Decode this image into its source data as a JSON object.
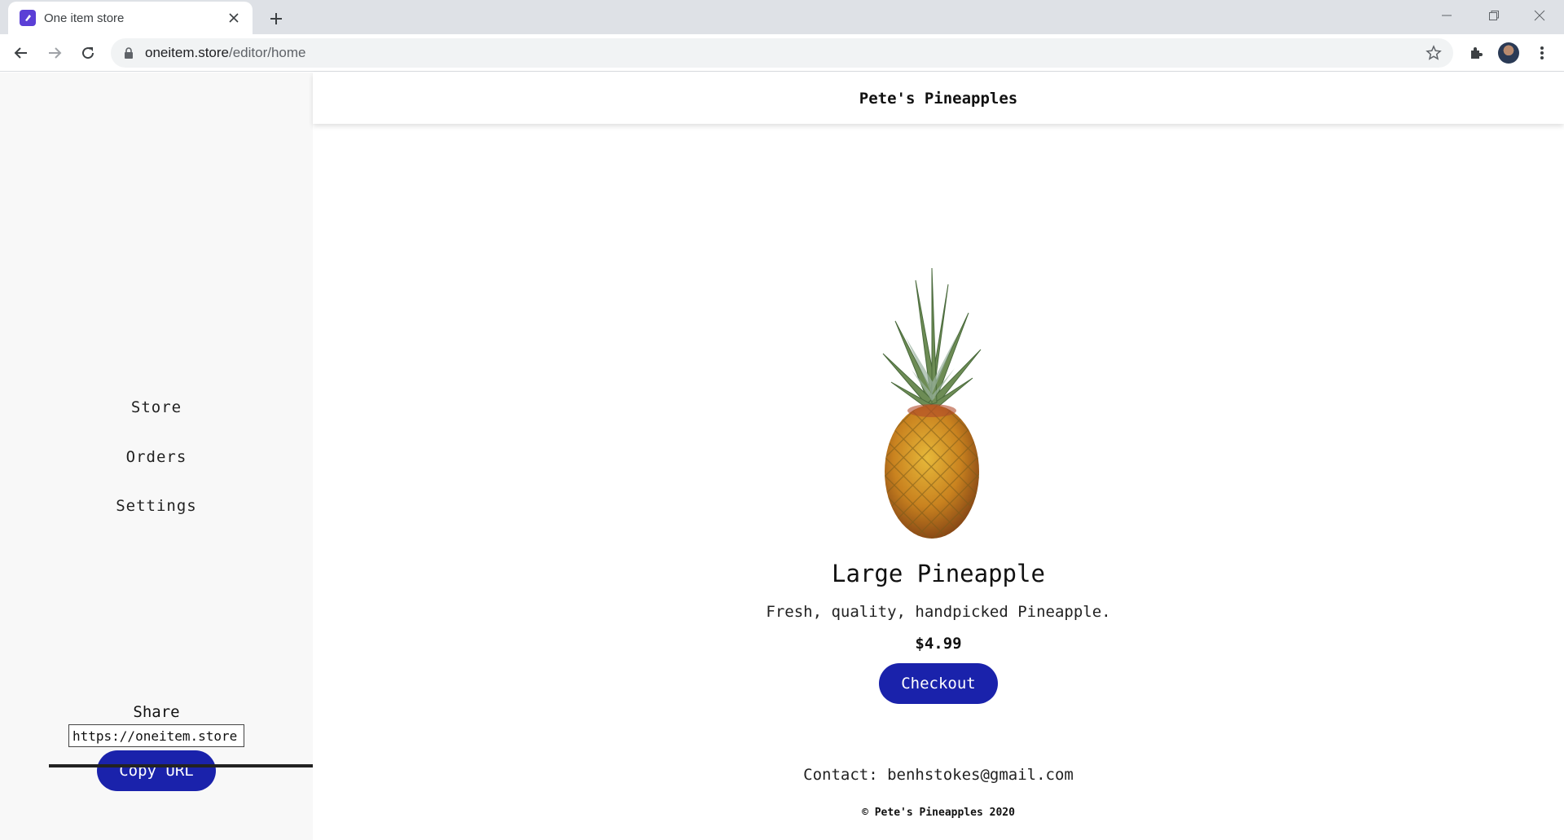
{
  "browser": {
    "tab_title": "One item store",
    "url_host": "oneitem.store",
    "url_path": "/editor/home"
  },
  "sidebar": {
    "items": [
      {
        "label": "Store"
      },
      {
        "label": "Orders"
      },
      {
        "label": "Settings"
      }
    ],
    "share_label": "Share",
    "share_url_value": "https://oneitem.store",
    "copy_button_label": "Copy URL"
  },
  "store": {
    "name": "Pete's Pineapples",
    "product_title": "Large Pineapple",
    "product_description": "Fresh, quality, handpicked Pineapple.",
    "price": "$4.99",
    "checkout_label": "Checkout",
    "contact": "Contact: benhstokes@gmail.com",
    "footer": "© Pete's Pineapples 2020"
  },
  "colors": {
    "accent": "#1a22ab",
    "sidebar_bg": "#f8f8f8",
    "favicon": "#5b3fd6"
  }
}
